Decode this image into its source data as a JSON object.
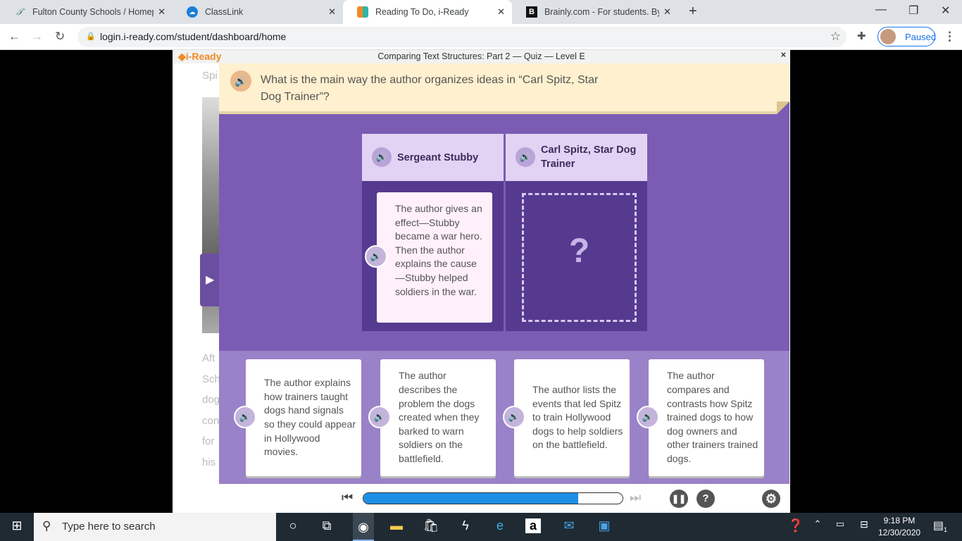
{
  "browser": {
    "tabs": [
      {
        "label": "Fulton County Schools / Homepage",
        "icon": "fulton-icon"
      },
      {
        "label": "ClassLink",
        "icon": "classlink-icon"
      },
      {
        "label": "Reading To Do, i-Ready",
        "icon": "iready-icon"
      },
      {
        "label": "Brainly.com - For students. By students.",
        "icon": "brainly-icon"
      }
    ],
    "url": "login.i-ready.com/student/dashboard/home",
    "profile_status": "Paused"
  },
  "background_text": [
    "Spi",
    "Aft",
    "Sch",
    "dog",
    "con",
    "for",
    "his"
  ],
  "app": {
    "logo": "i-Ready",
    "title": "Comparing Text Structures: Part 2 — Quiz — Level E",
    "close": "×"
  },
  "question": "What is the main way the author organizes ideas in “Carl Spitz, Star Dog Trainer”?",
  "columns": [
    {
      "title": "Sergeant Stubby",
      "card": "The author gives an effect—Stubby became a war hero. Then the author explains the cause—Stubby helped soldiers in the war."
    },
    {
      "title": "Carl Spitz, Star Dog Trainer",
      "placeholder": "?"
    }
  ],
  "options": [
    "The author explains how trainers taught dogs hand signals so they could appear in Hollywood movies.",
    "The author describes the problem the dogs created when they barked to warn soldiers on the battlefield.",
    "The author lists the events that led Spitz to train Hollywood dogs to help soldiers on the battlefield.",
    "The author compares and contrasts how Spitz trained dogs to how dog owners and other trainers trained dogs."
  ],
  "controls": {
    "progress_percent": 83,
    "help": "?"
  },
  "taskbar": {
    "search_placeholder": "Type here to search",
    "time": "9:18 PM",
    "date": "12/30/2020",
    "notifications": "1"
  },
  "colors": {
    "accent": "#7b5cb4",
    "progress": "#1e8fe6"
  }
}
